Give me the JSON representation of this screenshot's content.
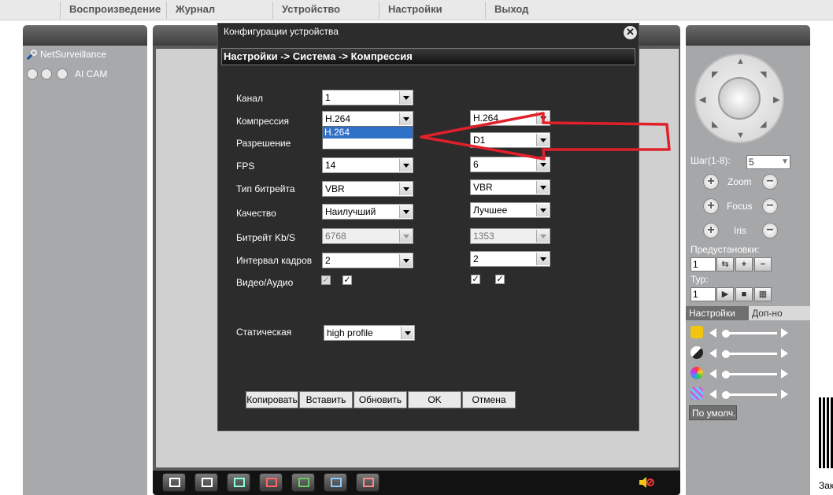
{
  "menu": {
    "items": [
      {
        "label": "Воспроизведение"
      },
      {
        "label": "Журнал"
      },
      {
        "label": "Устройство"
      },
      {
        "label": "Настройки"
      },
      {
        "label": "Выход"
      }
    ]
  },
  "left_panel": {
    "app_name": "NetSurveillance",
    "camera_name": "AI CAM"
  },
  "dialog": {
    "title": "Конфигурации устройства",
    "breadcrumb": "Настройки -> Система -> Компрессия",
    "labels": {
      "channel": "Канал",
      "compression": "Компрессия",
      "resolution": "Разрешение",
      "fps": "FPS",
      "bitrate_type": "Тип битрейта",
      "quality": "Качество",
      "bitrate": "Битрейт Kb/S",
      "interval": "Интервал кадров",
      "video_audio": "Видео/Аудио",
      "static": "Статическая"
    },
    "main": {
      "channel": "1",
      "compression": "H.264",
      "dropdown_option": "H.264",
      "fps": "14",
      "bitrate_type": "VBR",
      "quality": "Наилучший",
      "bitrate": "6768",
      "interval": "2",
      "video_checked": true,
      "audio_checked": true,
      "static": "high profile"
    },
    "extra": {
      "compression": "H.264",
      "resolution": "D1",
      "fps": "6",
      "bitrate_type": "VBR",
      "quality": "Лучшее",
      "bitrate": "1353",
      "interval": "2",
      "video_checked": true,
      "audio_checked": true
    },
    "buttons": {
      "copy": "Копировать",
      "paste": "Вставить",
      "refresh": "Обновить",
      "ok": "OK",
      "cancel": "Отмена"
    }
  },
  "right_panel": {
    "step_label": "Шаг(1-8):",
    "step_value": "5",
    "zoom_label": "Zoom",
    "focus_label": "Focus",
    "iris_label": "Iris",
    "presets_label": "Предустановки:",
    "preset_value": "1",
    "tour_label": "Тур:",
    "tour_value": "1",
    "tabs": {
      "settings": "Настройки",
      "extra": "Доп-но"
    },
    "default_button": "По умолч."
  },
  "edge_text": "Зак",
  "colors": {
    "arrow": "#e0202a",
    "selection": "#3071c8",
    "dialog_bg": "#2c2c2c"
  }
}
